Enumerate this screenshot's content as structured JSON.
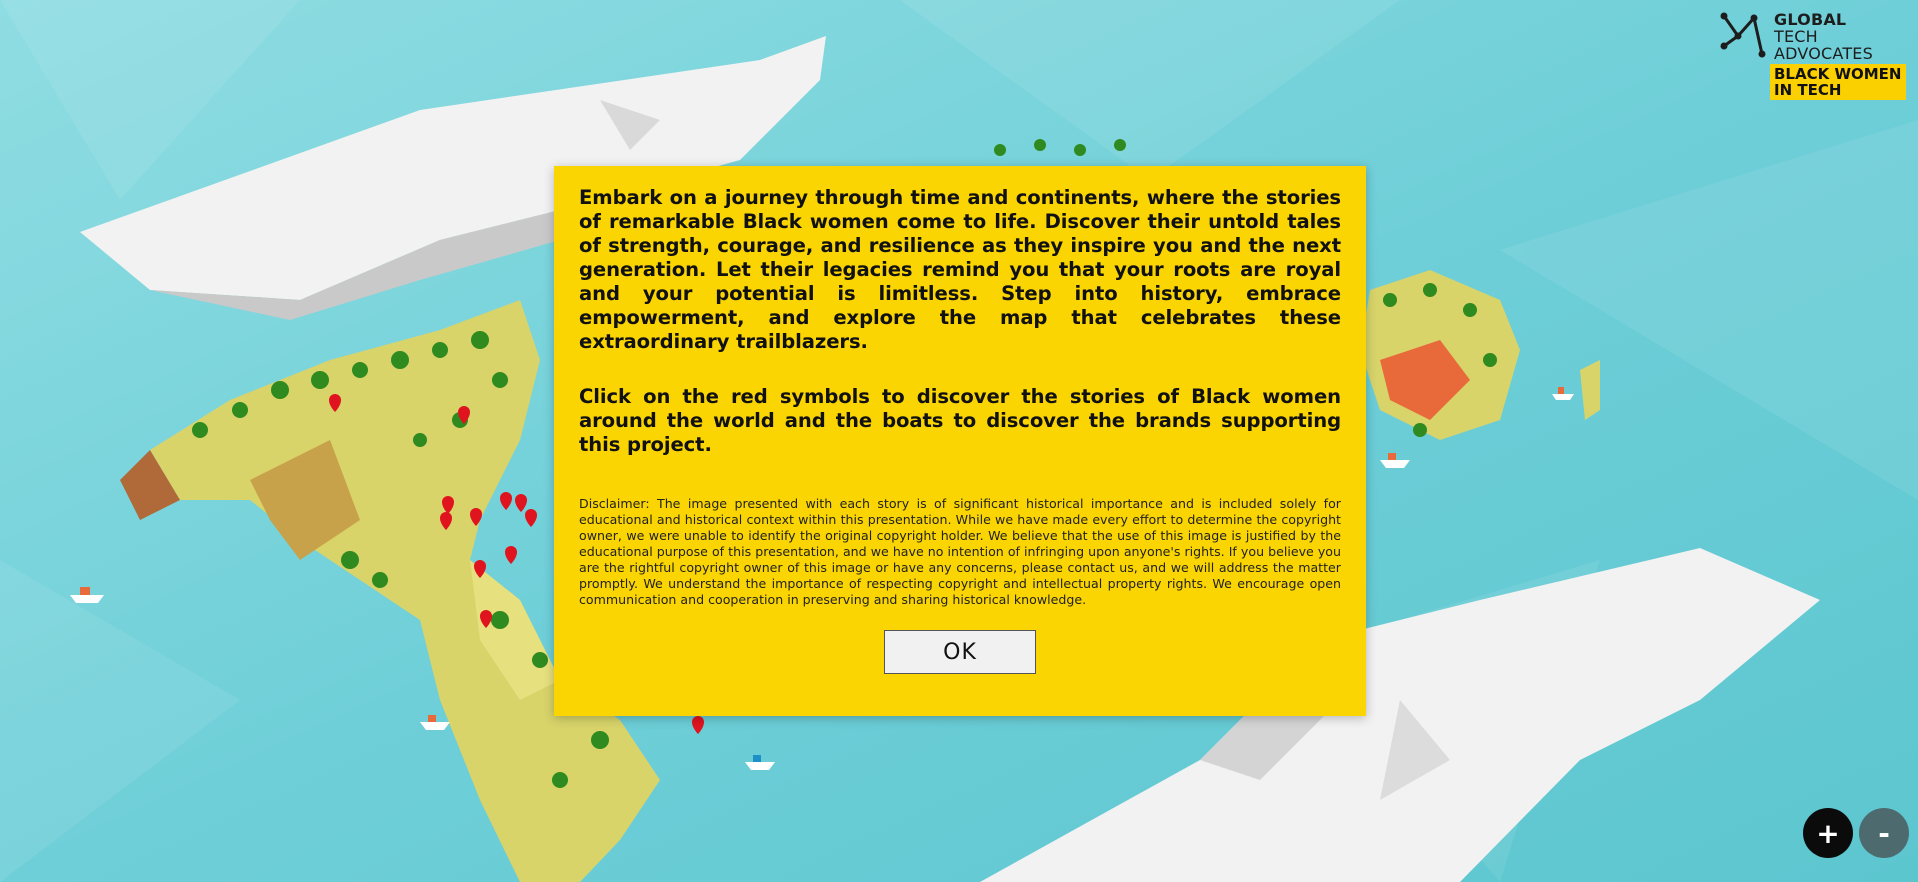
{
  "logo": {
    "line1": "GLOBAL",
    "line2": "TECH",
    "line3": "ADVOCATES",
    "badge_line1": "BLACK WOMEN",
    "badge_line2": "IN TECH",
    "badge_color": "#fbd000"
  },
  "modal": {
    "intro_text": "Embark on a journey through time and continents, where the stories of remarkable Black women come to life. Discover their untold tales of strength, courage, and resilience as they inspire you and the next generation. Let their legacies remind you that your roots are royal and your potential is limitless. Step into history, embrace empowerment, and explore the map that celebrates these extraordinary trailblazers.",
    "instruction_text": "Click on the red symbols to discover the stories of Black women around the world and the boats to discover the brands supporting this project.",
    "disclaimer_text": "Disclaimer: The image presented with each story is of significant historical importance and is included solely for educational and historical context within this presentation. While we have made every effort to determine the copyright owner, we were unable to identify the original copyright holder. We believe that the use of this image is justified by the educational purpose of this presentation, and we have no intention of infringing upon anyone's rights. If you believe you are the rightful copyright owner of this image or have any concerns, please contact us, and we will address the matter promptly. We understand the importance of respecting copyright and intellectual property rights. We encourage open communication and cooperation in preserving and sharing historical knowledge.",
    "ok_label": "OK",
    "background_color": "#fbd501"
  },
  "zoom": {
    "in_label": "+",
    "out_label": "-"
  },
  "colors": {
    "ocean": "#7fd6dd",
    "land": "#d9d46a",
    "ice": "#f4f4f4",
    "marker": "#e0141e"
  },
  "icons": [
    "logo-network-icon",
    "map-marker-icon",
    "boat-icon",
    "tree-icon"
  ]
}
